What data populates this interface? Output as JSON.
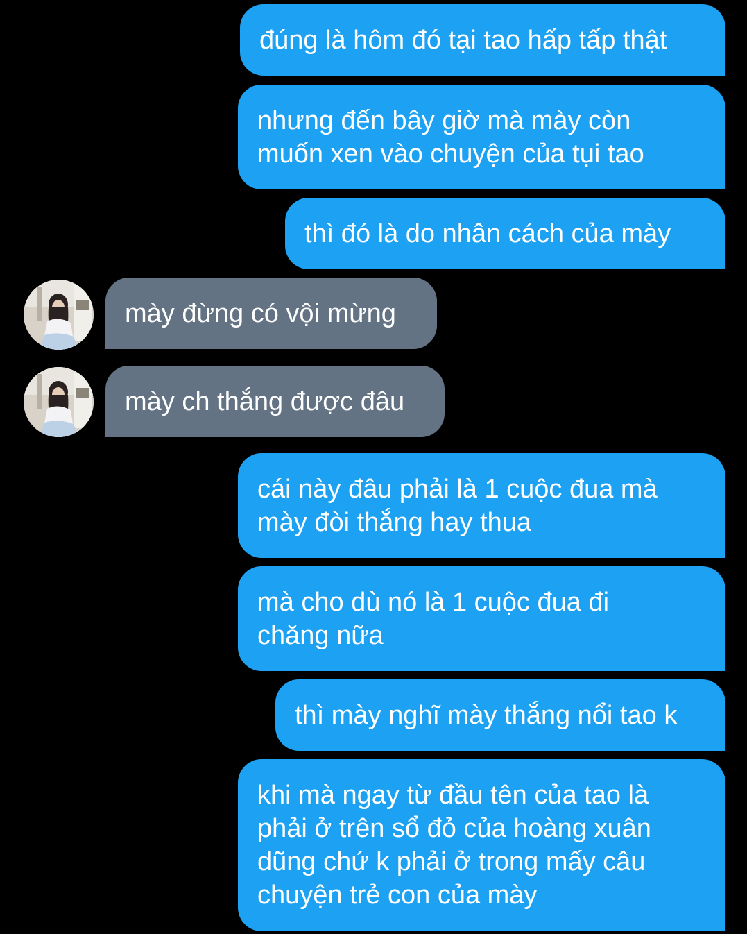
{
  "conversation": {
    "colors": {
      "background": "#000000",
      "sent_bubble": "#1da1f2",
      "received_bubble": "#637384",
      "text": "#ffffff"
    },
    "messages": [
      {
        "from": "me",
        "text": "đúng là hôm đó tại tao hấp tấp thật"
      },
      {
        "from": "me",
        "text": "nhưng đến bây giờ mà mày còn\nmuốn xen vào chuyện của tụi tao"
      },
      {
        "from": "me",
        "text": "thì đó là do nhân cách của mày"
      },
      {
        "from": "them",
        "avatar_icon": "girl-profile-photo",
        "text": "mày đừng có vội mừng"
      },
      {
        "from": "them",
        "avatar_icon": "girl-profile-photo",
        "text": "mày ch thắng được đâu"
      },
      {
        "from": "me",
        "text": "cái này đâu phải là 1 cuộc đua mà\nmày đòi thắng hay thua"
      },
      {
        "from": "me",
        "text": "mà cho dù nó là 1 cuộc đua đi\nchăng nữa"
      },
      {
        "from": "me",
        "text": "thì mày nghĩ mày thắng nổi tao k"
      },
      {
        "from": "me",
        "text": "khi mà ngay từ đầu tên của tao là\nphải ở trên sổ đỏ của hoàng xuân\ndũng chứ k phải ở trong mấy câu\nchuyện trẻ con của mày"
      }
    ]
  }
}
